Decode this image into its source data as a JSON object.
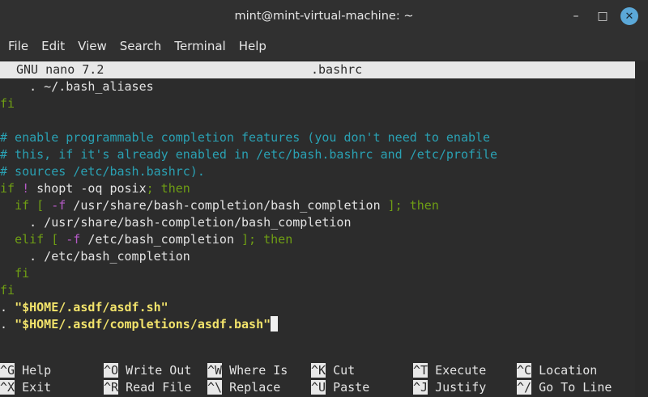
{
  "window": {
    "title": "mint@mint-virtual-machine: ~",
    "minimize_glyph": "–",
    "maximize_glyph": "□",
    "close_glyph": "✕"
  },
  "menubar": {
    "items": [
      "File",
      "Edit",
      "View",
      "Search",
      "Terminal",
      "Help"
    ]
  },
  "nano": {
    "version": "GNU nano 7.2",
    "filename": ".bashrc",
    "lines": [
      [
        {
          "t": "    . ~/.bash_aliases",
          "c": "plain"
        }
      ],
      [
        {
          "t": "fi",
          "c": "kw"
        }
      ],
      [],
      [
        {
          "t": "# enable programmable completion features (you don't need to enable",
          "c": "comment"
        }
      ],
      [
        {
          "t": "# this, if it's already enabled in /etc/bash.bashrc and /etc/profile",
          "c": "comment"
        }
      ],
      [
        {
          "t": "# sources /etc/bash.bashrc).",
          "c": "comment"
        }
      ],
      [
        {
          "t": "if",
          "c": "kw"
        },
        {
          "t": " ",
          "c": "plain"
        },
        {
          "t": "!",
          "c": "op"
        },
        {
          "t": " shopt -oq posix",
          "c": "plain"
        },
        {
          "t": "; then",
          "c": "kw"
        }
      ],
      [
        {
          "t": "  ",
          "c": "plain"
        },
        {
          "t": "if [",
          "c": "kw"
        },
        {
          "t": " ",
          "c": "plain"
        },
        {
          "t": "-f",
          "c": "op"
        },
        {
          "t": " /usr/share/bash-completion/bash_completion ",
          "c": "plain"
        },
        {
          "t": "]; then",
          "c": "kw"
        }
      ],
      [
        {
          "t": "    . /usr/share/bash-completion/bash_completion",
          "c": "plain"
        }
      ],
      [
        {
          "t": "  ",
          "c": "plain"
        },
        {
          "t": "elif [",
          "c": "kw"
        },
        {
          "t": " ",
          "c": "plain"
        },
        {
          "t": "-f",
          "c": "op"
        },
        {
          "t": " /etc/bash_completion ",
          "c": "plain"
        },
        {
          "t": "]; then",
          "c": "kw"
        }
      ],
      [
        {
          "t": "    . /etc/bash_completion",
          "c": "plain"
        }
      ],
      [
        {
          "t": "  ",
          "c": "plain"
        },
        {
          "t": "fi",
          "c": "kw"
        }
      ],
      [
        {
          "t": "fi",
          "c": "kw"
        }
      ],
      [
        {
          "t": ". ",
          "c": "plain"
        },
        {
          "t": "\"$HOME/.asdf/asdf.sh\"",
          "c": "str"
        }
      ],
      [
        {
          "t": ". ",
          "c": "plain"
        },
        {
          "t": "\"$HOME/.asdf/completions/asdf.bash\"",
          "c": "str"
        },
        {
          "t": "",
          "c": "cursor"
        }
      ]
    ],
    "shortcuts": [
      {
        "key": "^G",
        "label": " Help"
      },
      {
        "key": "^O",
        "label": " Write Out"
      },
      {
        "key": "^W",
        "label": " Where Is"
      },
      {
        "key": "^K",
        "label": " Cut"
      },
      {
        "key": "^T",
        "label": " Execute"
      },
      {
        "key": "^C",
        "label": " Location"
      },
      {
        "key": "^X",
        "label": " Exit"
      },
      {
        "key": "^R",
        "label": " Read File"
      },
      {
        "key": "^\\",
        "label": " Replace"
      },
      {
        "key": "^U",
        "label": " Paste"
      },
      {
        "key": "^J",
        "label": " Justify"
      },
      {
        "key": "^/",
        "label": " Go To Line"
      }
    ]
  },
  "colors": {
    "comment": "#2aa1b3",
    "keyword": "#6f9e14",
    "operator": "#b55ac6",
    "string": "#f2e36b",
    "close_button": "#5ba8d8"
  }
}
